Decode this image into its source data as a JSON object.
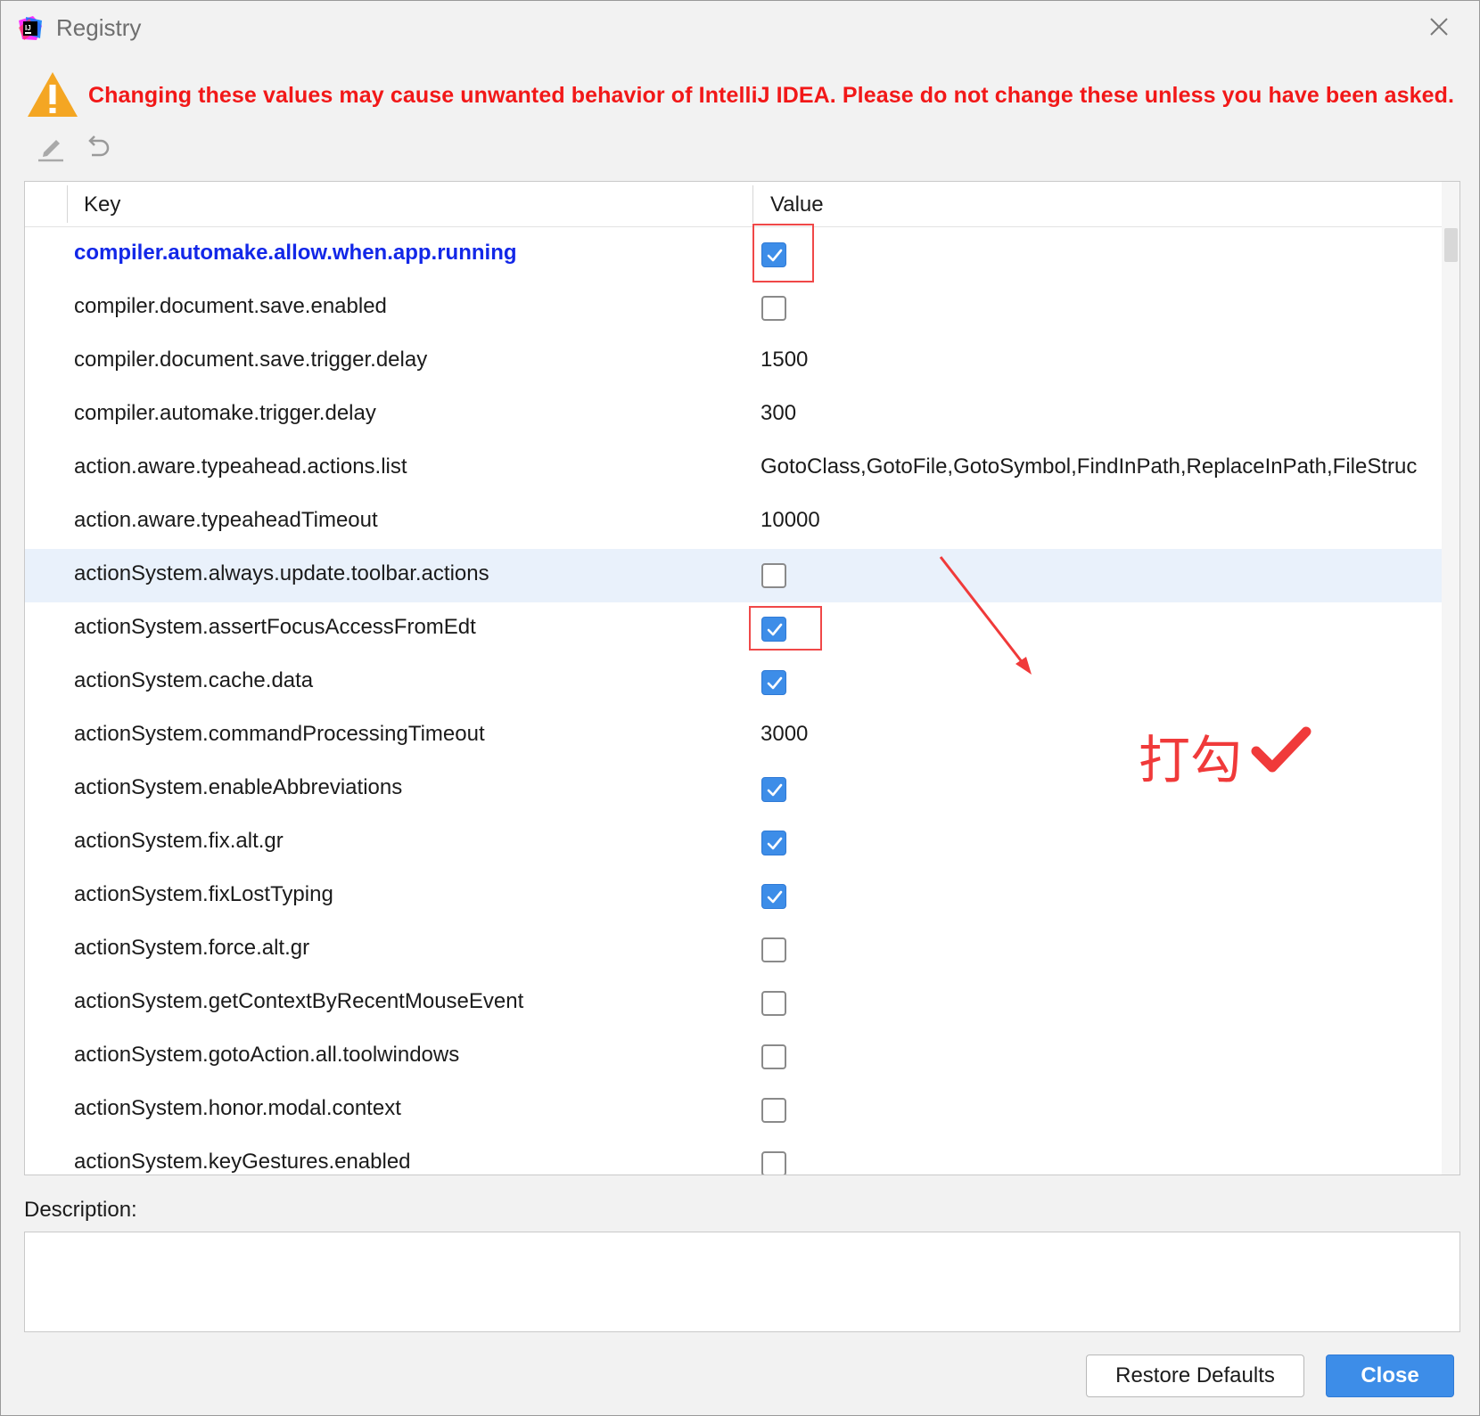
{
  "window": {
    "title": "Registry"
  },
  "warning": {
    "text": "Changing these values may cause unwanted behavior of IntelliJ IDEA. Please do not change these unless you have been asked."
  },
  "toolbar": {
    "edit_icon": "pencil-icon",
    "revert_icon": "undo-icon"
  },
  "table": {
    "headers": {
      "key": "Key",
      "value": "Value"
    },
    "rows": [
      {
        "key": "compiler.automake.allow.when.app.running",
        "type": "bool",
        "checked": true,
        "changed": true
      },
      {
        "key": "compiler.document.save.enabled",
        "type": "bool",
        "checked": false
      },
      {
        "key": "compiler.document.save.trigger.delay",
        "type": "text",
        "value": "1500"
      },
      {
        "key": "compiler.automake.trigger.delay",
        "type": "text",
        "value": "300"
      },
      {
        "key": "action.aware.typeahead.actions.list",
        "type": "text",
        "value": "GotoClass,GotoFile,GotoSymbol,FindInPath,ReplaceInPath,FileStruc"
      },
      {
        "key": "action.aware.typeaheadTimeout",
        "type": "text",
        "value": "10000"
      },
      {
        "key": "actionSystem.always.update.toolbar.actions",
        "type": "bool",
        "checked": false,
        "selected": true
      },
      {
        "key": "actionSystem.assertFocusAccessFromEdt",
        "type": "bool",
        "checked": true
      },
      {
        "key": "actionSystem.cache.data",
        "type": "bool",
        "checked": true
      },
      {
        "key": "actionSystem.commandProcessingTimeout",
        "type": "text",
        "value": "3000"
      },
      {
        "key": "actionSystem.enableAbbreviations",
        "type": "bool",
        "checked": true
      },
      {
        "key": "actionSystem.fix.alt.gr",
        "type": "bool",
        "checked": true
      },
      {
        "key": "actionSystem.fixLostTyping",
        "type": "bool",
        "checked": true
      },
      {
        "key": "actionSystem.force.alt.gr",
        "type": "bool",
        "checked": false
      },
      {
        "key": "actionSystem.getContextByRecentMouseEvent",
        "type": "bool",
        "checked": false
      },
      {
        "key": "actionSystem.gotoAction.all.toolwindows",
        "type": "bool",
        "checked": false
      },
      {
        "key": "actionSystem.honor.modal.context",
        "type": "bool",
        "checked": false
      },
      {
        "key": "actionSystem.keyGestures.enabled",
        "type": "bool",
        "checked": false
      }
    ]
  },
  "annotation": {
    "text": "打勾"
  },
  "description": {
    "label": "Description:",
    "value": ""
  },
  "buttons": {
    "restore": "Restore Defaults",
    "close": "Close"
  },
  "colors": {
    "warning_text": "#f21818",
    "changed_key": "#1227e8",
    "checkbox_on": "#3d8de8",
    "primary_button": "#3d8de8",
    "annotation_red": "#f03a3a",
    "selected_row": "#e9f1fb"
  }
}
